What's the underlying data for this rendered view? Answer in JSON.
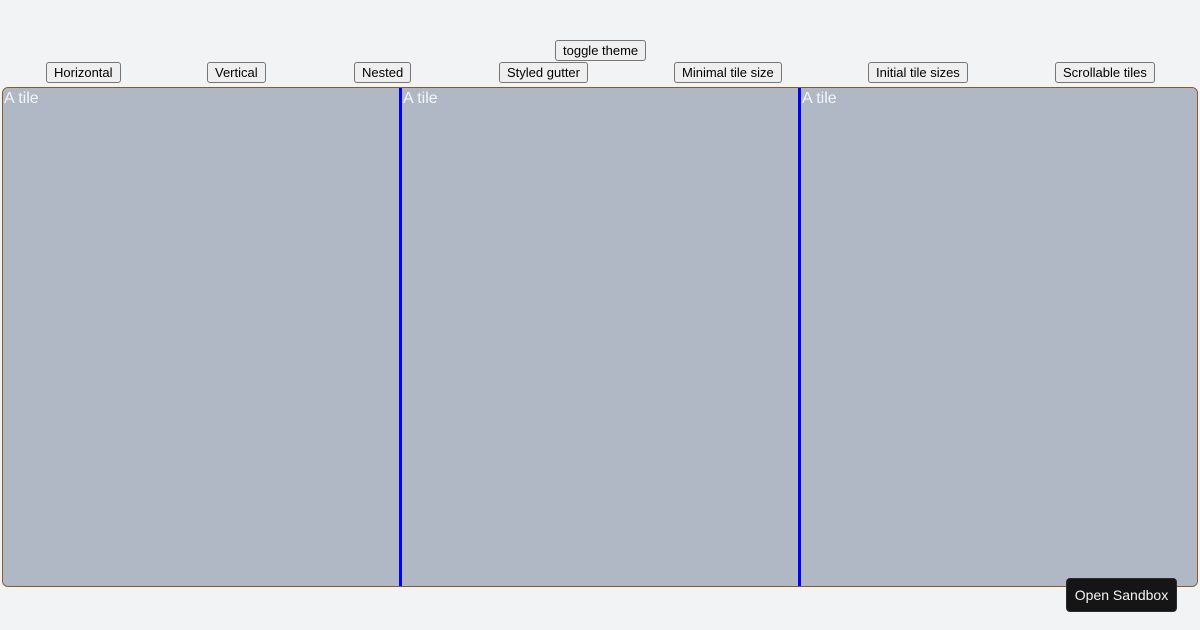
{
  "toolbar": {
    "toggle_theme": "toggle theme",
    "examples": [
      {
        "label": "Horizontal"
      },
      {
        "label": "Vertical"
      },
      {
        "label": "Nested"
      },
      {
        "label": "Styled gutter"
      },
      {
        "label": "Minimal tile size"
      },
      {
        "label": "Initial tile sizes"
      },
      {
        "label": "Scrollable tiles"
      }
    ]
  },
  "tiles": [
    {
      "label": "A tile"
    },
    {
      "label": "A tile"
    },
    {
      "label": "A tile"
    }
  ],
  "colors": {
    "gutter": "#0000ff",
    "tile_background": "#afb8c4",
    "container_border": "#8b5a2b"
  },
  "sandbox": {
    "label": "Open Sandbox"
  }
}
